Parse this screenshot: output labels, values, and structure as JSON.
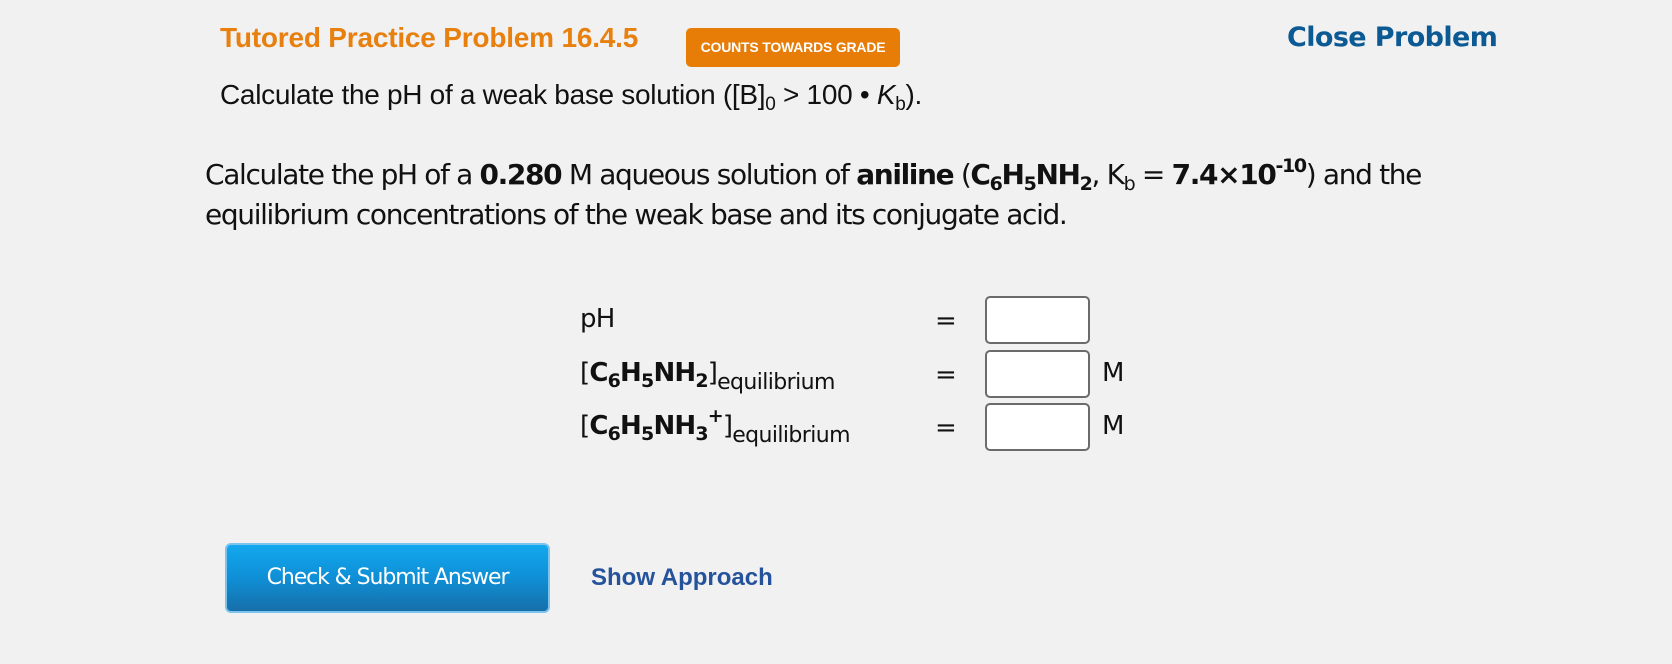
{
  "header": {
    "title": "Tutored Practice Problem 16.4.5",
    "badge": "COUNTS TOWARDS GRADE",
    "close_label": "Close Problem"
  },
  "subtitle": {
    "prefix": "Calculate the pH of a weak base solution ([B]",
    "sub": "0",
    "middle": " > 100 • ",
    "k": "K",
    "k_sub": "b",
    "suffix": ")."
  },
  "problem": {
    "t1": "Calculate the pH of a ",
    "concentration": "0.280",
    "t2": " M aqueous solution of ",
    "compound": "aniline",
    "t3": " (",
    "f_c": "C",
    "f_c_n": "6",
    "f_h": "H",
    "f_h_n": "5",
    "f_nh": "NH",
    "f_nh_n": "2",
    "t4": ", K",
    "kb_sub": "b",
    "t5": " = ",
    "kb_mant": "7.4×10",
    "kb_exp": "-10",
    "t6": ") and the equilibrium concentrations of the weak base and its conjugate acid."
  },
  "answers": {
    "equals": "=",
    "rows": [
      {
        "label": "pH",
        "value": "",
        "unit": ""
      },
      {
        "open": "[",
        "c": "C",
        "c_n": "6",
        "h": "H",
        "h_n": "5",
        "nh": "NH",
        "nh_n": "2",
        "charge": "",
        "close": "]",
        "eq": "equilibrium",
        "value": "",
        "unit": "M"
      },
      {
        "open": "[",
        "c": "C",
        "c_n": "6",
        "h": "H",
        "h_n": "5",
        "nh": "NH",
        "nh_n": "3",
        "charge": "+",
        "close": "]",
        "eq": "equilibrium",
        "value": "",
        "unit": "M"
      }
    ]
  },
  "actions": {
    "submit_label": "Check & Submit Answer",
    "approach_label": "Show Approach"
  },
  "colors": {
    "title": "#e8800f",
    "badge": "#e77c07",
    "close_link": "#0b5a94",
    "submit_button": "#0f8fd6",
    "approach_link": "#24529b",
    "background": "#f1f1f1"
  }
}
